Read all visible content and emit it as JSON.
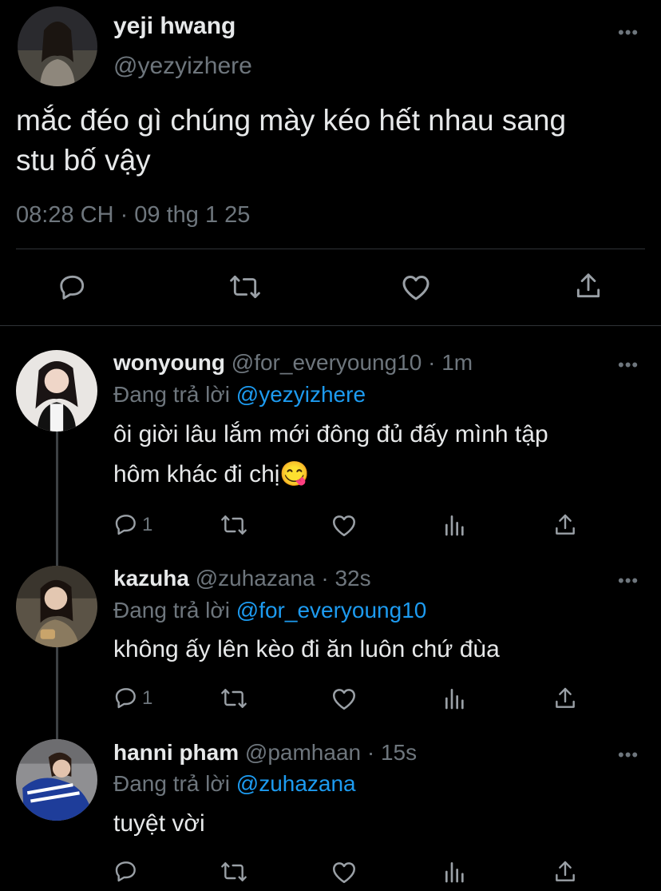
{
  "main_tweet": {
    "display_name": "yeji hwang",
    "handle": "@yezyizhere",
    "text_line1": "mắc đéo gì chúng mày kéo hết nhau sang",
    "text_line2": "stu bố vậy",
    "timestamp": "08:28 CH · 09 thg 1 25",
    "more": "•••"
  },
  "replies": [
    {
      "display_name": "wonyoung",
      "meta": "@for_everyoung10 · 1m",
      "replying_prefix": "Đang trả lời",
      "replying_to": "@yezyizhere",
      "text_line1": "ôi giời lâu lắm mới đông đủ đấy mình tập",
      "text_line2": "hôm khác đi chị😋",
      "reply_count": "1",
      "more": "•••"
    },
    {
      "display_name": "kazuha",
      "meta": "@zuhazana · 32s",
      "replying_prefix": "Đang trả lời",
      "replying_to": "@for_everyoung10",
      "text_line1": "không ấy lên kèo đi ăn luôn chứ đùa",
      "reply_count": "1",
      "more": "•••"
    },
    {
      "display_name": "hanni pham",
      "meta": "@pamhaan · 15s",
      "replying_prefix": "Đang trả lời",
      "replying_to": "@zuhazana",
      "text_line1": "tuyệt vời",
      "more": "•••"
    }
  ],
  "icons": {
    "reply": "reply-bubble-icon",
    "retweet": "retweet-icon",
    "like": "heart-icon",
    "share": "share-upload-icon",
    "views": "analytics-bars-icon",
    "more": "more-dots-icon"
  },
  "colors": {
    "background": "#000000",
    "text": "#e7e9ea",
    "muted": "#6e767d",
    "link": "#1d9bf0",
    "divider": "#2f3336"
  }
}
